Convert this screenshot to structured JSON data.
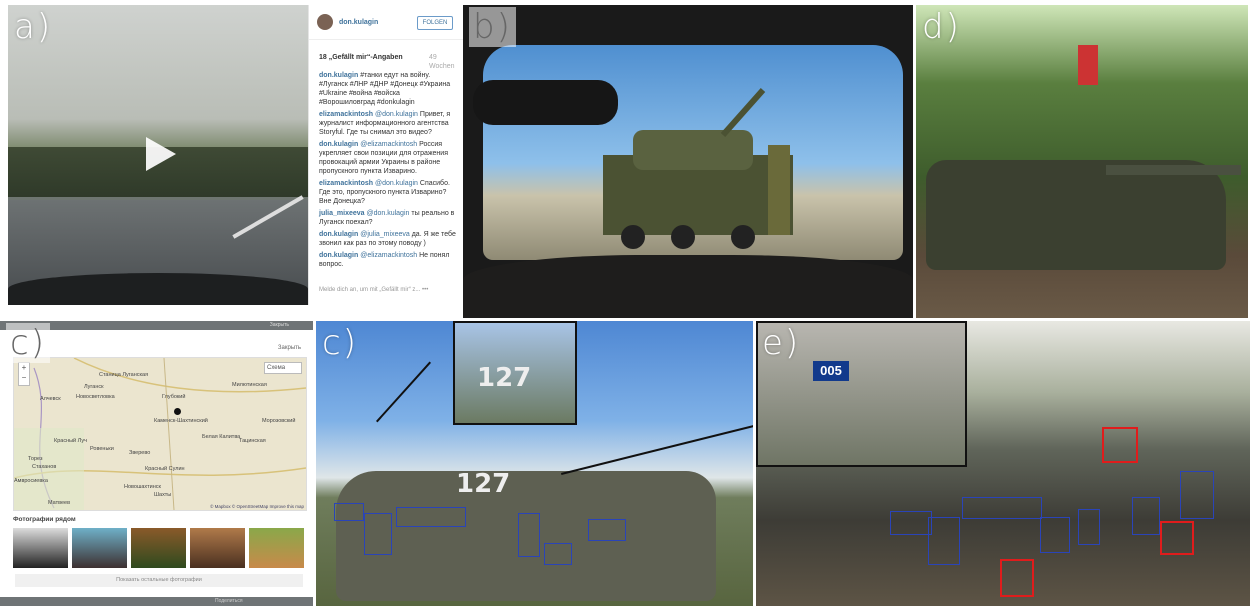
{
  "labels": {
    "a": "a)",
    "b": "b)",
    "d": "d)",
    "c1": "c)",
    "c2": "c)",
    "e": "e)"
  },
  "instagram": {
    "username": "don.kulagin",
    "follow_button": "FOLGEN",
    "likes": "18 „Gefällt mir“-Angaben",
    "when": "49 Wochen",
    "comments": [
      {
        "user": "don.kulagin",
        "text": "#танки едут на войну. #Луганск #ЛНР #ДНР #Донецк #Украина #Ukraine #война #войска #Ворошиловград #donkulagin"
      },
      {
        "user": "elizamackintosh",
        "mention": "@don.kulagin",
        "text": "Привет, я журналист информационного агентства Storyful. Где ты снимал это видео?"
      },
      {
        "user": "don.kulagin",
        "mention": "@elizamackintosh",
        "text": "Россия укрепляет свои позиции для отражения провокаций армии Украины в районе пропускного пункта Изварино."
      },
      {
        "user": "elizamackintosh",
        "mention": "@don.kulagin",
        "text": "Спасибо. Где это, пропускного пункта Изварино? Вне Донецка?"
      },
      {
        "user": "julia_mixeeva",
        "mention": "@don.kulagin",
        "text": "ты реально в Луганск поехал?"
      },
      {
        "user": "don.kulagin",
        "mention": "@julia_mixeeva",
        "text": "да. Я же тебе звонил как раз по этому поводу )"
      },
      {
        "user": "don.kulagin",
        "mention": "@elizamackintosh",
        "text": "Не понял вопрос."
      }
    ],
    "login_prompt": "Melde dich an, um mit „Gefällt mir“ z...",
    "dots": "•••"
  },
  "map_panel": {
    "close_top": "Закрыть",
    "close": "Закрыть",
    "map_type": "Схема",
    "zoom_in": "+",
    "zoom_out": "−",
    "places": [
      "Станица Луганская",
      "Луганск",
      "Новосветловка",
      "Алчевск",
      "Глубокий",
      "Милютинская",
      "Каменск-Шахтинский",
      "Морозовский",
      "Красный Луч",
      "Ровеньки",
      "Белая Калитва",
      "Тацинская",
      "Торез",
      "Стаханов",
      "Зверево",
      "Красный Сулин",
      "Новошахтинск",
      "Шахты",
      "Амвросиевка",
      "Матвеев"
    ],
    "attribution": "© Mapbox © OpenStreetMap  Improve this map",
    "photos_heading": "Фотографии рядом",
    "show_more": "Показать остальные фотографии",
    "bottom_bar": "Поделиться"
  },
  "tank_numbers": {
    "c_main": "127",
    "c_inset": "127",
    "e_inset": "005"
  }
}
